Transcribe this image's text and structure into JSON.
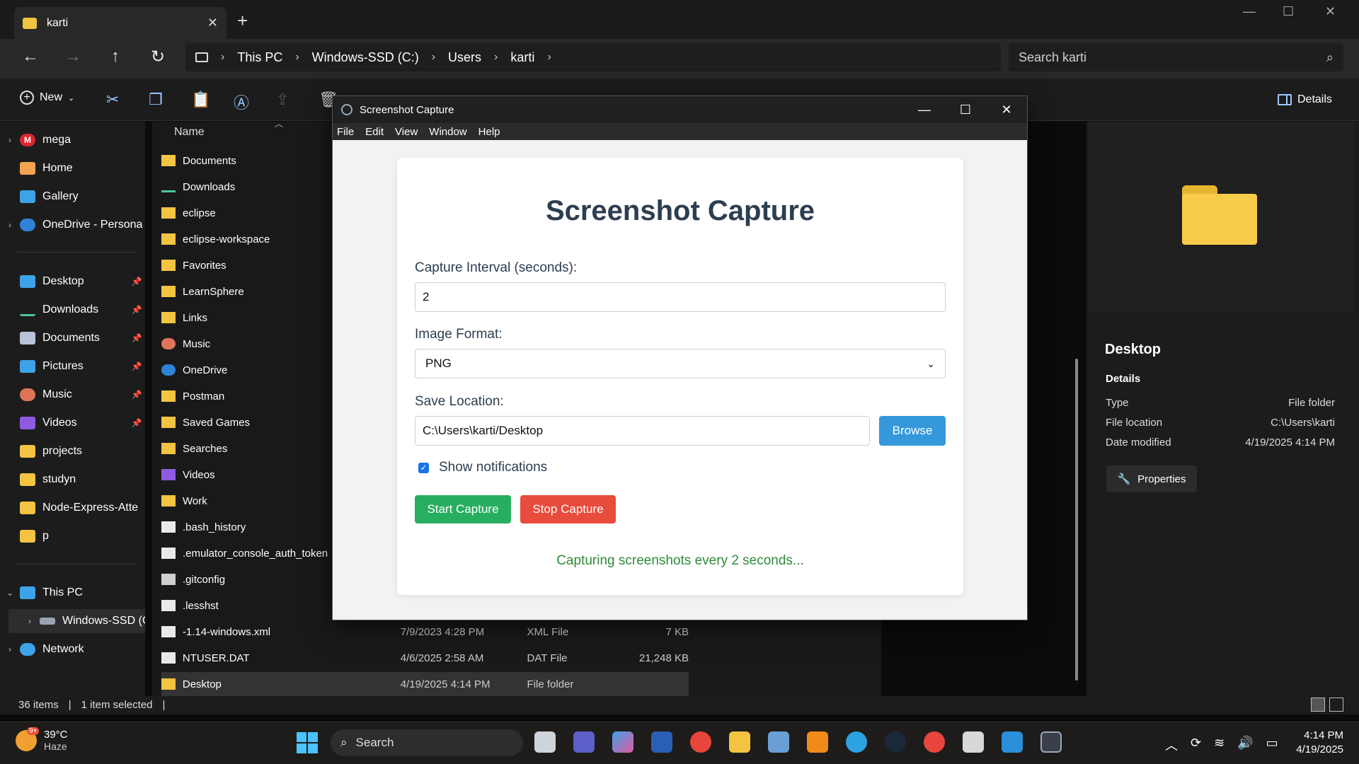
{
  "explorer": {
    "tab_title": "karti",
    "new_tab": "+",
    "window_controls": [
      "—",
      "☐",
      "✕"
    ],
    "breadcrumb": [
      "This PC",
      "Windows-SSD (C:)",
      "Users",
      "karti"
    ],
    "search_placeholder": "Search karti",
    "new_label": "New",
    "details_label": "Details",
    "nav_items": [
      {
        "label": "mega",
        "icon": "mega-icon",
        "chevron": "›"
      },
      {
        "label": "Home",
        "icon": "home-icon",
        "chevron": ""
      },
      {
        "label": "Gallery",
        "icon": "gallery-icon",
        "chevron": ""
      },
      {
        "label": "OneDrive - Persona",
        "icon": "onedrive-icon",
        "chevron": "›"
      },
      {
        "label": "Desktop",
        "icon": "desktop-icon",
        "chevron": "",
        "pinned": true
      },
      {
        "label": "Downloads",
        "icon": "downloads-icon",
        "chevron": "",
        "pinned": true
      },
      {
        "label": "Documents",
        "icon": "documents-icon",
        "chevron": "",
        "pinned": true
      },
      {
        "label": "Pictures",
        "icon": "pictures-icon",
        "chevron": "",
        "pinned": true
      },
      {
        "label": "Music",
        "icon": "music-icon",
        "chevron": "",
        "pinned": true
      },
      {
        "label": "Videos",
        "icon": "videos-icon",
        "chevron": "",
        "pinned": true
      },
      {
        "label": "projects",
        "icon": "folder-icon",
        "chevron": ""
      },
      {
        "label": "studyn",
        "icon": "folder-icon",
        "chevron": ""
      },
      {
        "label": "Node-Express-Atte",
        "icon": "folder-icon",
        "chevron": ""
      },
      {
        "label": "p",
        "icon": "folder-icon",
        "chevron": ""
      },
      {
        "label": "This PC",
        "icon": "pc-icon",
        "chevron": "⌄"
      },
      {
        "label": "Windows-SSD (C:",
        "icon": "drive-icon",
        "chevron": "›"
      },
      {
        "label": "Network",
        "icon": "network-icon",
        "chevron": "›"
      }
    ],
    "column_name": "Name",
    "files": [
      {
        "name": "Documents",
        "icon": "documents-folder-icon",
        "date": "",
        "type": "",
        "size": ""
      },
      {
        "name": "Downloads",
        "icon": "downloads-icon",
        "date": "",
        "type": "",
        "size": ""
      },
      {
        "name": "eclipse",
        "icon": "folder-icon",
        "date": "",
        "type": "",
        "size": ""
      },
      {
        "name": "eclipse-workspace",
        "icon": "folder-icon",
        "date": "",
        "type": "",
        "size": ""
      },
      {
        "name": "Favorites",
        "icon": "folder-icon",
        "date": "",
        "type": "",
        "size": ""
      },
      {
        "name": "LearnSphere",
        "icon": "folder-icon",
        "date": "",
        "type": "",
        "size": ""
      },
      {
        "name": "Links",
        "icon": "folder-icon",
        "date": "",
        "type": "",
        "size": ""
      },
      {
        "name": "Music",
        "icon": "music-icon",
        "date": "",
        "type": "",
        "size": ""
      },
      {
        "name": "OneDrive",
        "icon": "onedrive-icon",
        "date": "",
        "type": "",
        "size": ""
      },
      {
        "name": "Postman",
        "icon": "folder-icon",
        "date": "",
        "type": "",
        "size": ""
      },
      {
        "name": "Saved Games",
        "icon": "folder-icon",
        "date": "",
        "type": "",
        "size": ""
      },
      {
        "name": "Searches",
        "icon": "folder-icon",
        "date": "",
        "type": "",
        "size": ""
      },
      {
        "name": "Videos",
        "icon": "videos-icon",
        "date": "",
        "type": "",
        "size": ""
      },
      {
        "name": "Work",
        "icon": "folder-icon",
        "date": "",
        "type": "",
        "size": ""
      },
      {
        "name": ".bash_history",
        "icon": "file-icon",
        "date": "",
        "type": "",
        "size": ""
      },
      {
        "name": ".emulator_console_auth_token",
        "icon": "file-icon",
        "date": "",
        "type": "",
        "size": ""
      },
      {
        "name": ".gitconfig",
        "icon": "config-file-icon",
        "date": "",
        "type": "",
        "size": ""
      },
      {
        "name": ".lesshst",
        "icon": "file-icon",
        "date": "",
        "type": "",
        "size": ""
      },
      {
        "name": "-1.14-windows.xml",
        "icon": "file-icon",
        "date": "7/9/2023 4:28 PM",
        "type": "XML File",
        "size": "7 KB"
      },
      {
        "name": "NTUSER.DAT",
        "icon": "file-icon",
        "date": "4/6/2025 2:58 AM",
        "type": "DAT File",
        "size": "21,248 KB"
      },
      {
        "name": "Desktop",
        "icon": "folder-icon",
        "date": "4/19/2025 4:14 PM",
        "type": "File folder",
        "size": ""
      }
    ],
    "details": {
      "title": "Desktop",
      "section": "Details",
      "rows": [
        {
          "label": "Type",
          "value": "File folder"
        },
        {
          "label": "File location",
          "value": "C:\\Users\\karti"
        },
        {
          "label": "Date modified",
          "value": "4/19/2025 4:14 PM"
        }
      ],
      "properties_label": "Properties"
    },
    "status": {
      "items": "36 items",
      "selected": "1 item selected"
    }
  },
  "app": {
    "window_title": "Screenshot Capture",
    "menu": [
      "File",
      "Edit",
      "View",
      "Window",
      "Help"
    ],
    "heading": "Screenshot Capture",
    "interval_label": "Capture Interval (seconds):",
    "interval_value": "2",
    "format_label": "Image Format:",
    "format_value": "PNG",
    "location_label": "Save Location:",
    "location_value": "C:\\Users\\karti/Desktop",
    "browse_label": "Browse",
    "notifications_label": "Show notifications",
    "notifications_checked": true,
    "start_label": "Start Capture",
    "stop_label": "Stop Capture",
    "status_message": "Capturing screenshots every 2 seconds...",
    "colors": {
      "start": "#27ae60",
      "stop": "#e74c3c",
      "browse": "#3498db",
      "status": "#2e8b3a",
      "heading": "#2c3e50"
    }
  },
  "taskbar": {
    "weather_temp": "39°C",
    "weather_cond": "Haze",
    "weather_badge": "9+",
    "search_label": "Search",
    "time": "4:14 PM",
    "date": "4/19/2025",
    "apps": [
      "files-icon",
      "teams-icon",
      "copilot-icon",
      "word-icon",
      "chrome-icon",
      "file-explorer-icon",
      "photos-icon",
      "vlc-icon",
      "telegram-icon",
      "steam-icon",
      "chrome-profile-icon",
      "snipping-icon",
      "vscode-icon",
      "electron-app-icon"
    ]
  }
}
